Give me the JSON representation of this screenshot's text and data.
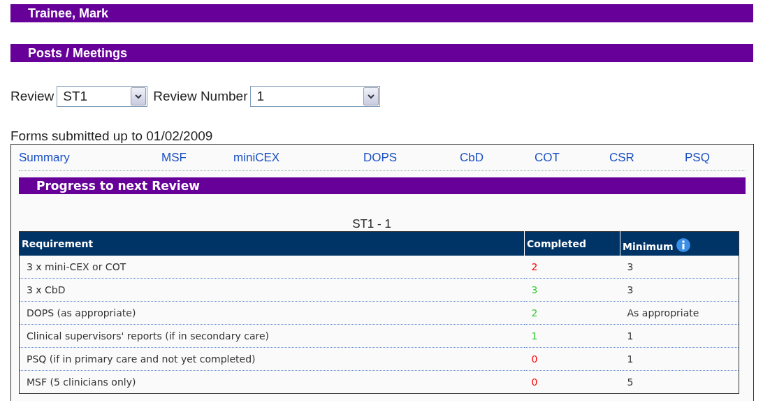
{
  "headers": [
    "Trainee, Mark",
    "Posts / Meetings"
  ],
  "filters": [
    {
      "label": "Review",
      "value": "ST1"
    },
    {
      "label": "Review Number",
      "value": "1"
    }
  ],
  "forms_note": "Forms submitted up to 01/02/2009",
  "tabs": [
    {
      "label": "Summary"
    },
    {
      "label": "MSF"
    },
    {
      "label": "miniCEX"
    },
    {
      "label": "DOPS"
    },
    {
      "label": "CbD"
    },
    {
      "label": "COT"
    },
    {
      "label": "CSR"
    },
    {
      "label": "PSQ"
    }
  ],
  "section_title": "Progress to next Review",
  "table_caption": "ST1 - 1",
  "table": {
    "columns": [
      "Requirement",
      "Completed",
      "Minimum"
    ],
    "rows": [
      {
        "requirement": "3 x mini-CEX or COT",
        "completed": "2",
        "color": "#ff0000",
        "minimum": "3"
      },
      {
        "requirement": "3 x CbD",
        "completed": "3",
        "color": "#33cc33",
        "minimum": "3"
      },
      {
        "requirement": "DOPS (as appropriate)",
        "completed": "2",
        "color": "#33cc33",
        "minimum": "As appropriate"
      },
      {
        "requirement": "Clinical supervisors' reports (if in secondary care)",
        "completed": "1",
        "color": "#33cc33",
        "minimum": "1"
      },
      {
        "requirement": "PSQ (if in primary care and not yet completed)",
        "completed": "0",
        "color": "#ff0000",
        "minimum": "1"
      },
      {
        "requirement": "MSF (5 clinicians only)",
        "completed": "0",
        "color": "#ff0000",
        "minimum": "5"
      }
    ]
  }
}
